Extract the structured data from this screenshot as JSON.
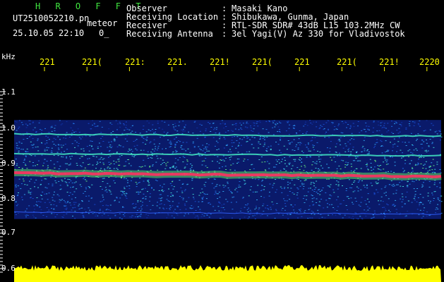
{
  "header": {
    "app_title": "H R O F F T",
    "filename": "UT2510052210.pn",
    "mode": "meteor",
    "datetime": "25.10.05 22:10",
    "counter": "0_",
    "info": [
      {
        "label": "Observer",
        "sep": ":",
        "value": "Masaki Kano"
      },
      {
        "label": "Receiving Location",
        "sep": ":",
        "value": "Shibukawa, Gunma, Japan"
      },
      {
        "label": "Receiver",
        "sep": ":",
        "value": "RTL-SDR SDR# 43dB L15 103.2MHz CW"
      },
      {
        "label": "Receiving Antenna",
        "sep": ":",
        "value": "3el Yagi(V) Az 330 for Vladivostok"
      }
    ]
  },
  "chart_data": {
    "type": "heatmap",
    "ylabel": "kHz",
    "x_tick_labels": [
      "221",
      "221(",
      "221:",
      "221.",
      "221!",
      "221(",
      "221",
      "221(",
      "221!",
      "2220"
    ],
    "y_ticks": [
      "1.1",
      "1.0",
      "0.9",
      "0.8",
      "0.7",
      "0.6"
    ],
    "ylim": [
      0.6,
      1.15
    ],
    "bands": [
      {
        "freq": 0.87,
        "level": "strong",
        "color": "#ff3060"
      },
      {
        "freq": 0.98,
        "level": "medium",
        "color": "#40e0c0"
      },
      {
        "freq": 0.925,
        "level": "medium",
        "color": "#40e0c0"
      },
      {
        "freq": 0.76,
        "level": "weak",
        "color": "#3060ff"
      }
    ],
    "noise_range_khz": [
      0.74,
      1.02
    ],
    "bottom_bar_color": "#ffff00",
    "tick_color": "#ffff00"
  },
  "colors": {
    "background": "#000000",
    "text": "#ffffff",
    "title": "#40e840",
    "axis_labels": "#ffff00"
  }
}
